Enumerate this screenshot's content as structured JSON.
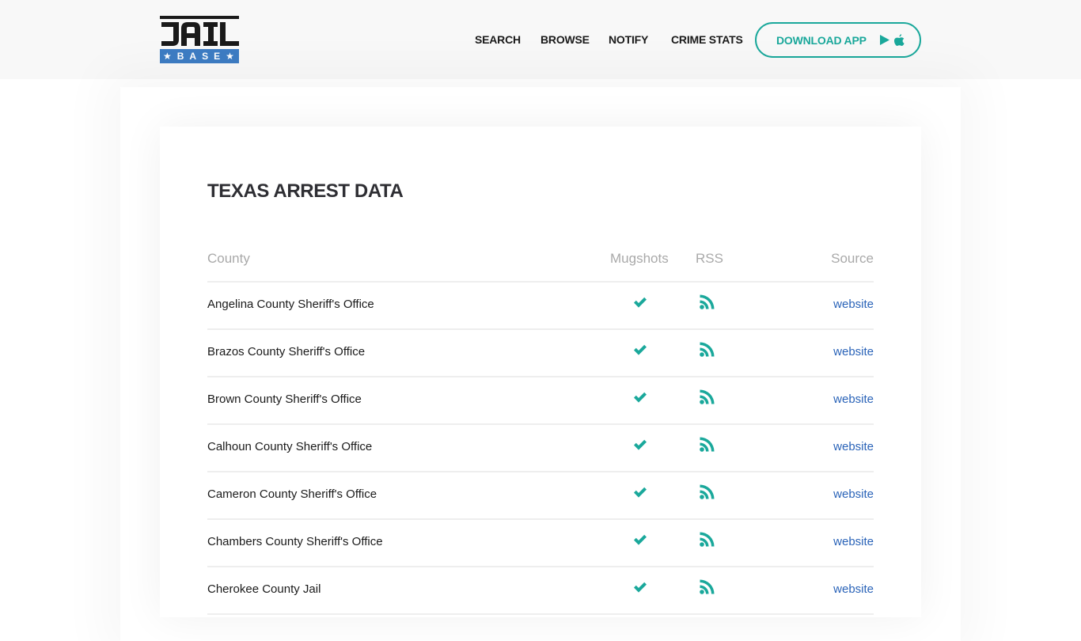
{
  "header": {
    "logo": {
      "top_text": "JAIL",
      "bottom_text": "★BASE★"
    },
    "nav": [
      {
        "label": "SEARCH"
      },
      {
        "label": "BROWSE"
      },
      {
        "label": "NOTIFY"
      },
      {
        "label": "CRIME STATS"
      }
    ],
    "download_button": {
      "label": "DOWNLOAD APP",
      "icons": [
        "google-play-icon",
        "apple-icon"
      ]
    }
  },
  "main": {
    "title": "TEXAS ARREST DATA",
    "table": {
      "columns": [
        "County",
        "Mugshots",
        "RSS",
        "Source"
      ],
      "rows": [
        {
          "county": "Angelina County Sheriff's Office",
          "mugshots": true,
          "rss": true,
          "source": "website"
        },
        {
          "county": "Brazos County Sheriff's Office",
          "mugshots": true,
          "rss": true,
          "source": "website"
        },
        {
          "county": "Brown County Sheriff's Office",
          "mugshots": true,
          "rss": true,
          "source": "website"
        },
        {
          "county": "Calhoun County Sheriff's Office",
          "mugshots": true,
          "rss": true,
          "source": "website"
        },
        {
          "county": "Cameron County Sheriff's Office",
          "mugshots": true,
          "rss": true,
          "source": "website"
        },
        {
          "county": "Chambers County Sheriff's Office",
          "mugshots": true,
          "rss": true,
          "source": "website"
        },
        {
          "county": "Cherokee County Jail",
          "mugshots": true,
          "rss": true,
          "source": "website"
        }
      ]
    }
  },
  "colors": {
    "accent": "#1aa89b",
    "link": "#2a63b8",
    "logo_blue": "#3d7cc3",
    "header_bg": "#f8f8f8"
  }
}
